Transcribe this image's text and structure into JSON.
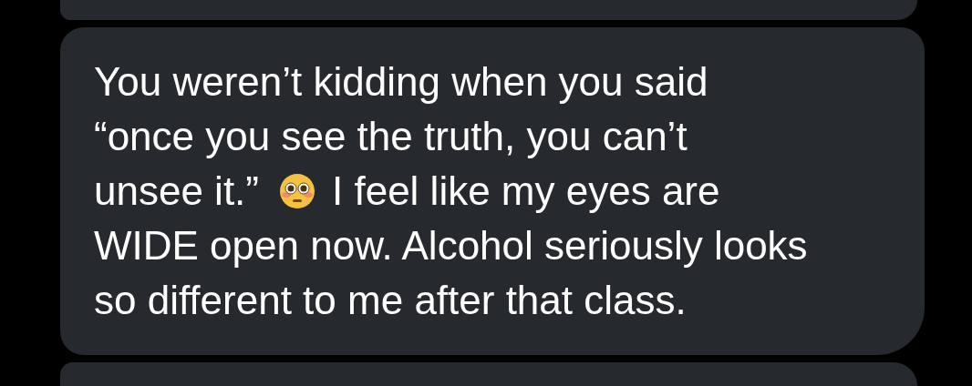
{
  "messages": [
    {
      "kind": "clipped_above"
    },
    {
      "kind": "message",
      "lines": [
        [
          {
            "kind": "text",
            "text": "You weren’t kidding when you said"
          }
        ],
        [
          {
            "kind": "text",
            "text": "“once you see the truth, you can’t"
          }
        ],
        [
          {
            "kind": "text",
            "text": "unsee it.”"
          },
          {
            "kind": "emoji"
          },
          {
            "kind": "text",
            "text": "I feel like my eyes are"
          }
        ],
        [
          {
            "kind": "text",
            "text": "WIDE open now. Alcohol seriously looks"
          }
        ],
        [
          {
            "kind": "text",
            "text": "so different to me after that class."
          }
        ]
      ]
    },
    {
      "kind": "clipped_below"
    }
  ]
}
